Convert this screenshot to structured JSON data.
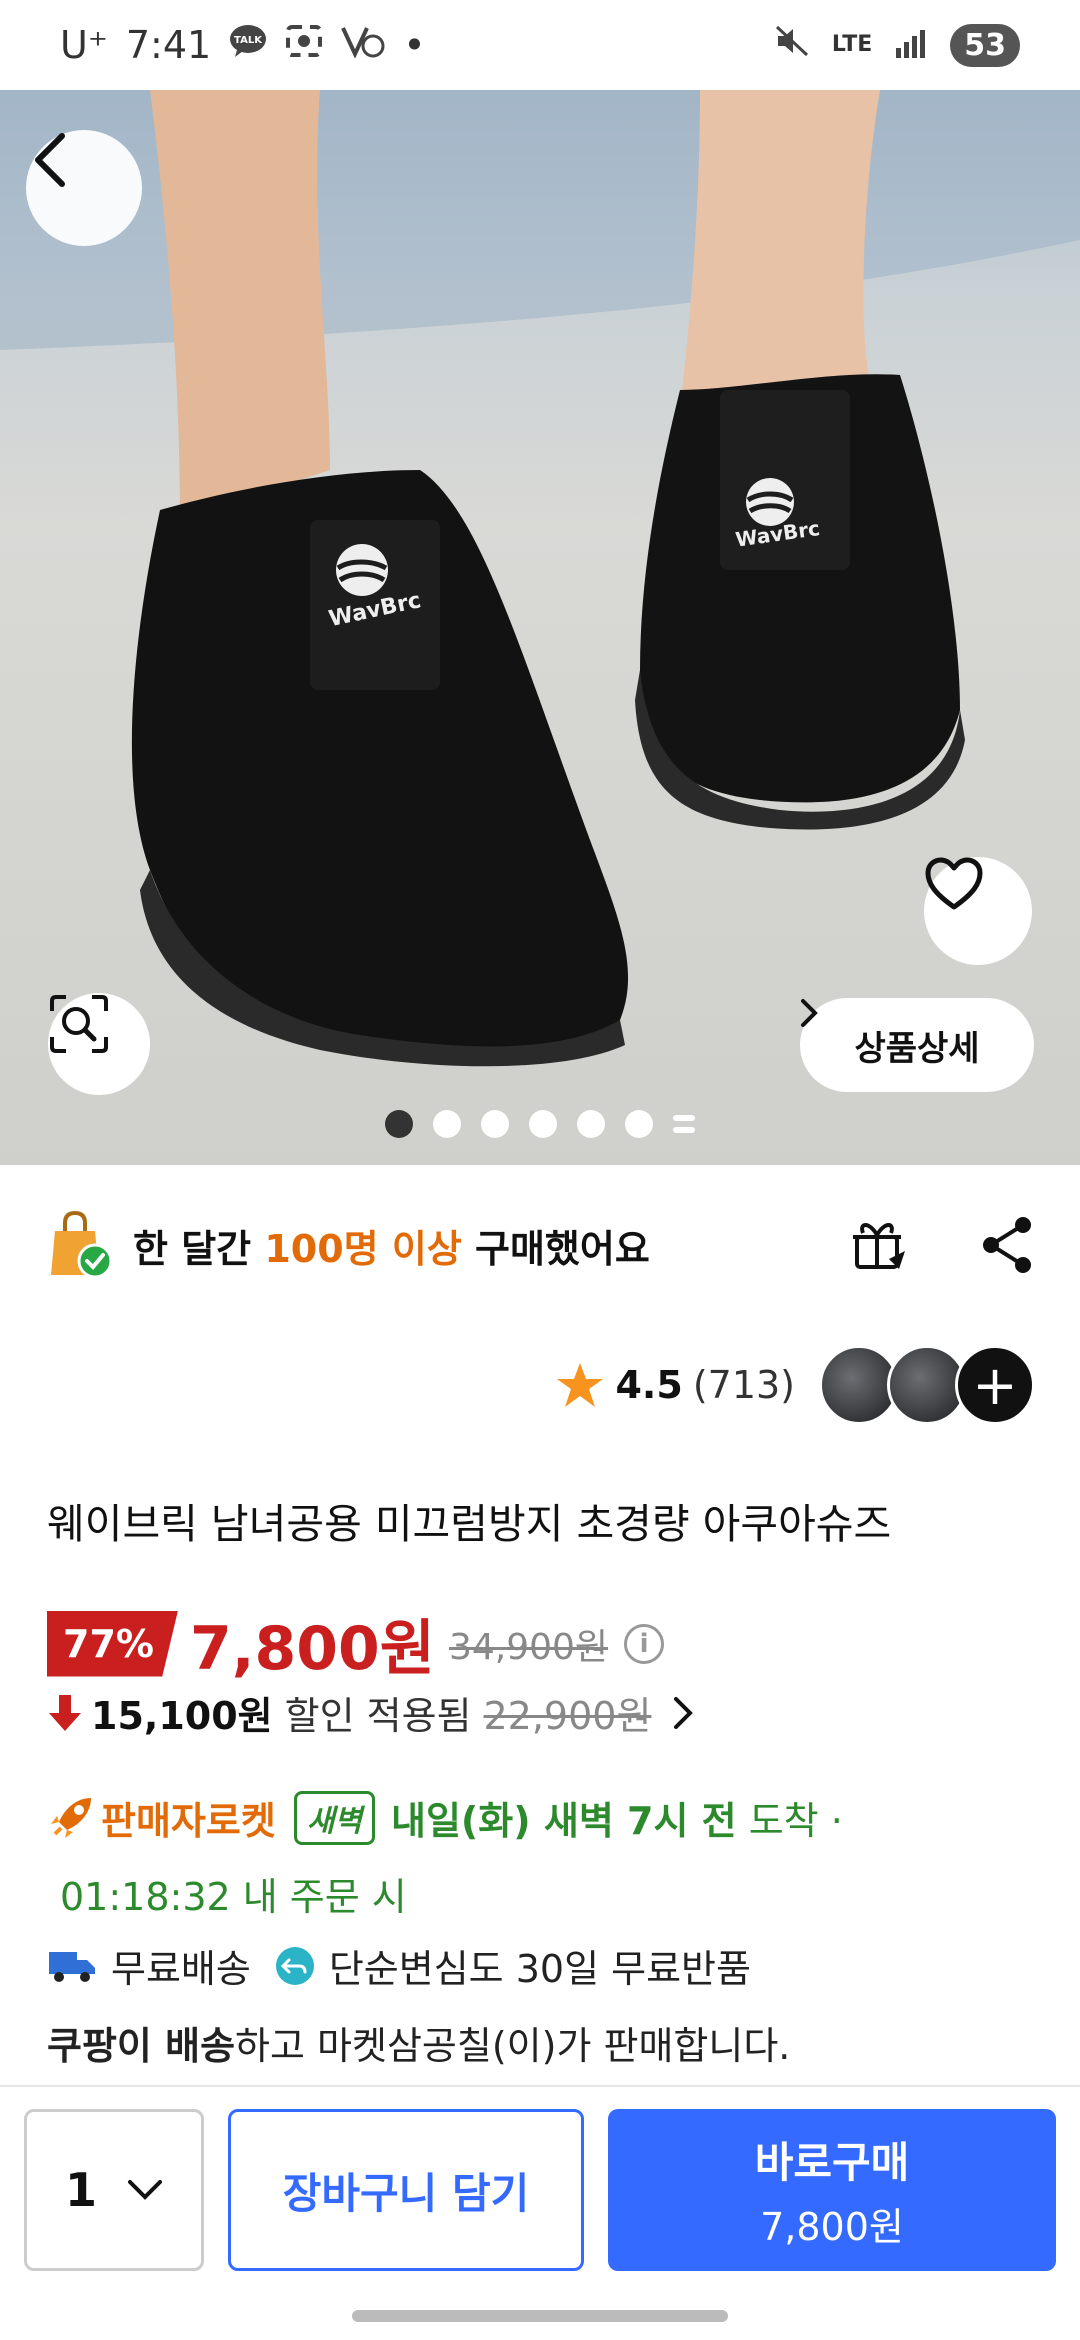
{
  "status_bar": {
    "carrier": "U⁺",
    "time": "7:41",
    "talk_icon": "TALK",
    "network": "LTE",
    "battery": "53"
  },
  "hero": {
    "brand_on_shoe": "WavBrc",
    "detail_button_label": "상품상세",
    "carousel_dots": 7,
    "active_dot": 0
  },
  "popularity": {
    "prefix": "한 달간 ",
    "highlight": "100명 이상",
    "suffix": " 구매했어요"
  },
  "rating": {
    "score": "4.5",
    "count": "(713)"
  },
  "product": {
    "title": "웨이브릭 남녀공용 미끄럼방지 초경량 아쿠아슈즈",
    "discount": "77%",
    "price": "7,800원",
    "original_price": "34,900원",
    "info_icon": "i",
    "saving_amount": "15,100원",
    "saving_text": "할인 적용됨",
    "saving_was": "22,900원"
  },
  "delivery": {
    "rocket_label": "판매자로켓",
    "badge": "새벽",
    "eta_bold": "내일(화) 새벽 7시 전",
    "eta_tail": " 도착 ·",
    "cutoff": "01:18:32 내 주문 시",
    "free_shipping": "무료배송",
    "free_return": "단순변심도 30일 무료반품",
    "seller_bold": "쿠팡이 배송",
    "seller_rest": "하고 마켓삼공칠(이)가 판매합니다."
  },
  "bottom_bar": {
    "quantity": "1",
    "cart_label": "장바구니 담기",
    "buy_label": "바로구매",
    "buy_price": "7,800원"
  },
  "colors": {
    "accent_blue": "#346aff",
    "sale_red": "#c91f1f",
    "orange": "#e36b07",
    "green": "#2c8a2c"
  }
}
